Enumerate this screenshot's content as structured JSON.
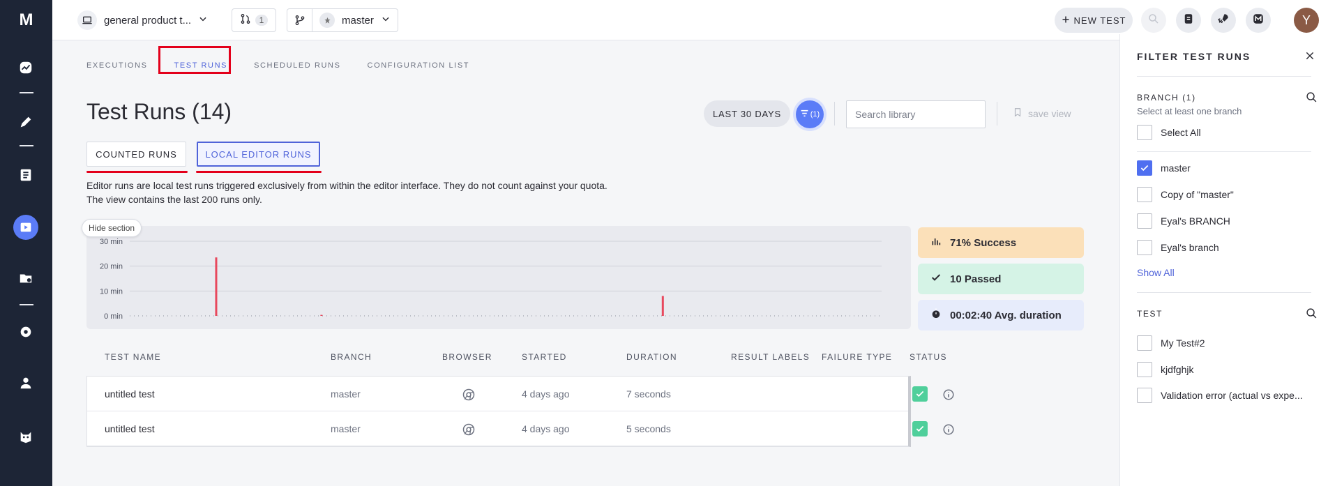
{
  "app": {
    "logo": "M"
  },
  "topbar": {
    "project": "general product t...",
    "pr_count": "1",
    "branch": "master",
    "new_test": "NEW TEST",
    "avatar": "Y"
  },
  "tabs": [
    {
      "label": "EXECUTIONS",
      "active": false
    },
    {
      "label": "TEST RUNS",
      "active": true
    },
    {
      "label": "SCHEDULED RUNS",
      "active": false
    },
    {
      "label": "CONFIGURATION LIST",
      "active": false
    }
  ],
  "page": {
    "title": "Test Runs (14)",
    "period": "LAST 30 DAYS",
    "filter_count": "(1)",
    "search_placeholder": "Search library",
    "save_view": "save view",
    "seg_counted": "COUNTED RUNS",
    "seg_local": "LOCAL EDITOR RUNS",
    "desc_line1": "Editor runs are local test runs triggered exclusively from within the editor interface. They do not count against your quota.",
    "desc_line2": "The view contains the last 200 runs only.",
    "hide_section": "Hide section"
  },
  "stats": {
    "success": "71% Success",
    "passed": "10 Passed",
    "duration": "00:02:40 Avg. duration"
  },
  "chart_data": {
    "type": "bar",
    "y_ticks": [
      "30 min",
      "20 min",
      "10 min",
      "0 min"
    ],
    "ylim": [
      0,
      30
    ],
    "bars": [
      {
        "position": 0.115,
        "value": 23.5,
        "color": "#e8485d"
      },
      {
        "position": 0.255,
        "value": 0.4,
        "color": "#e8485d"
      },
      {
        "position": 0.709,
        "value": 8,
        "color": "#e8485d"
      }
    ],
    "grid": true
  },
  "table": {
    "columns": [
      "TEST NAME",
      "BRANCH",
      "BROWSER",
      "STARTED",
      "DURATION",
      "RESULT LABELS",
      "FAILURE TYPE",
      "STATUS"
    ],
    "rows": [
      {
        "name": "untitled test",
        "branch": "master",
        "started": "4 days ago",
        "duration": "7 seconds"
      },
      {
        "name": "untitled test",
        "branch": "master",
        "started": "4 days ago",
        "duration": "5 seconds"
      }
    ]
  },
  "filter_panel": {
    "title": "FILTER TEST RUNS",
    "branch_header": "BRANCH (1)",
    "branch_sub": "Select at least one branch",
    "select_all": "Select All",
    "branches": [
      {
        "label": "master",
        "checked": true
      },
      {
        "label": "Copy of \"master\"",
        "checked": false
      },
      {
        "label": "Eyal's BRANCH",
        "checked": false
      },
      {
        "label": "Eyal's branch",
        "checked": false
      }
    ],
    "show_all": "Show All",
    "test_header": "TEST",
    "tests": [
      {
        "label": "My Test#2",
        "checked": false
      },
      {
        "label": "kjdfghjk",
        "checked": false
      },
      {
        "label": "Validation error (actual vs expe...",
        "checked": false
      }
    ]
  }
}
